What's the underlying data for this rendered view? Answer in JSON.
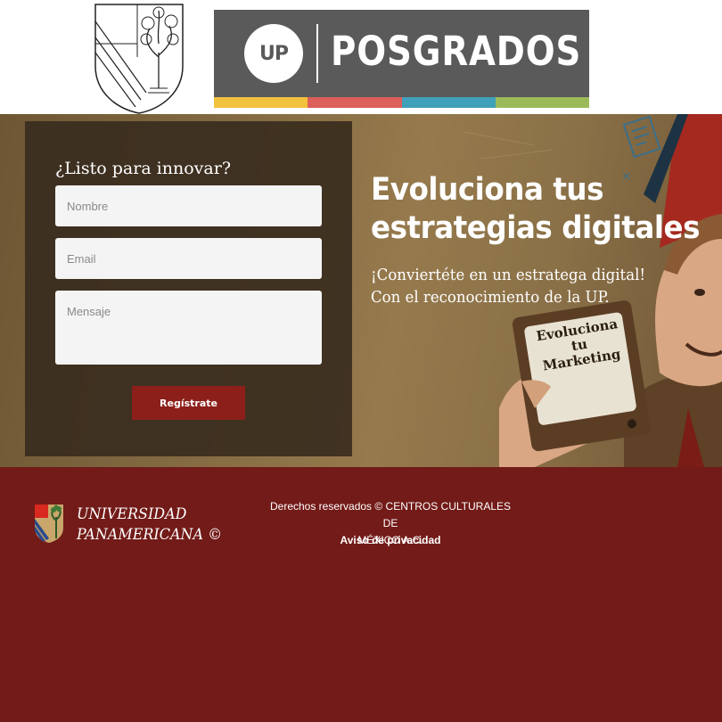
{
  "header": {
    "logo_text": "UP",
    "brand_word": "POSGRADOS",
    "stripe_colors": [
      "#f3c23c",
      "#dc5f5a",
      "#3fa0b9",
      "#9bbb59"
    ]
  },
  "form": {
    "title": "¿Listo para innovar?",
    "name_placeholder": "Nombre",
    "email_placeholder": "Email",
    "message_placeholder": "Mensaje",
    "submit_label": "Regístrate"
  },
  "hero": {
    "title_line1": "Evoluciona tus",
    "title_line2": "estrategias digitales",
    "subtitle_line1": "¡Conviertéte en un estratega digital!",
    "subtitle_line2": "Con el reconocimiento de la UP.",
    "sign_line1": "Evoluciona",
    "sign_line2": "tu",
    "sign_line3": "Marketing"
  },
  "footer": {
    "brand_line1": "UNIVERSIDAD",
    "brand_line2": "PANAMERICANA ©",
    "copyright_line1": "Derechos reservados © CENTROS CULTURALES DE",
    "copyright_line2": "MÉXICO A.C.",
    "privacy_link": "Aviso de privacidad"
  },
  "colors": {
    "footer_bg": "#721b18",
    "button_bg": "#8c1f1a",
    "form_panel_bg": "#3a2c1e",
    "banner_bg": "#5a5a5a"
  }
}
